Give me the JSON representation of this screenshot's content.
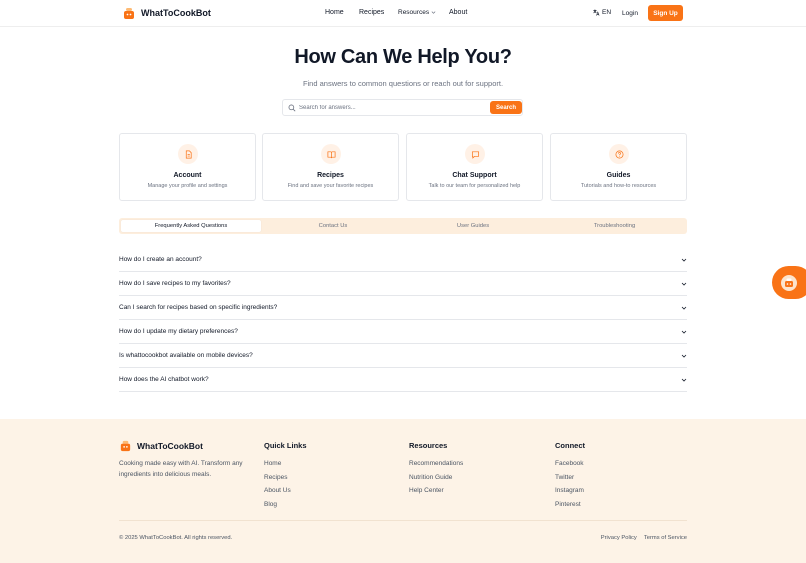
{
  "brand": {
    "name": "WhatToCookBot",
    "accent": "#f97316"
  },
  "header": {
    "nav": {
      "home": "Home",
      "recipes": "Recipes",
      "resources": "Resources",
      "about": "About"
    },
    "lang": "EN",
    "login": "Login",
    "signup": "Sign Up"
  },
  "hero": {
    "title": "How Can We Help You?",
    "subtitle": "Find answers to common questions or reach out for support.",
    "search_placeholder": "Search for answers...",
    "search_button": "Search"
  },
  "cards": [
    {
      "icon": "document-icon",
      "title": "Account",
      "desc": "Manage your profile and settings"
    },
    {
      "icon": "book-icon",
      "title": "Recipes",
      "desc": "Find and save your favorite recipes"
    },
    {
      "icon": "chat-bubble-icon",
      "title": "Chat Support",
      "desc": "Talk to our team for personalized help"
    },
    {
      "icon": "help-circle-icon",
      "title": "Guides",
      "desc": "Tutorials and how-to resources"
    }
  ],
  "tabs": [
    {
      "label": "Frequently Asked Questions",
      "active": true
    },
    {
      "label": "Contact Us",
      "active": false
    },
    {
      "label": "User Guides",
      "active": false
    },
    {
      "label": "Troubleshooting",
      "active": false
    }
  ],
  "faq": [
    "How do I create an account?",
    "How do I save recipes to my favorites?",
    "Can I search for recipes based on specific ingredients?",
    "How do I update my dietary preferences?",
    "Is whattocookbot available on mobile devices?",
    "How does the AI chatbot work?"
  ],
  "footer": {
    "brand": "WhatToCookBot",
    "tagline": "Cooking made easy with AI. Transform any ingredients into delicious meals.",
    "quick_links": {
      "title": "Quick Links",
      "links": [
        "Home",
        "Recipes",
        "About Us",
        "Blog"
      ]
    },
    "resources": {
      "title": "Resources",
      "links": [
        "Recommendations",
        "Nutrition Guide",
        "Help Center"
      ]
    },
    "connect": {
      "title": "Connect",
      "links": [
        "Facebook",
        "Twitter",
        "Instagram",
        "Pinterest"
      ]
    },
    "copyright": "© 2025 WhatToCookBot. All rights reserved.",
    "privacy": "Privacy Policy",
    "terms": "Terms of Service"
  }
}
